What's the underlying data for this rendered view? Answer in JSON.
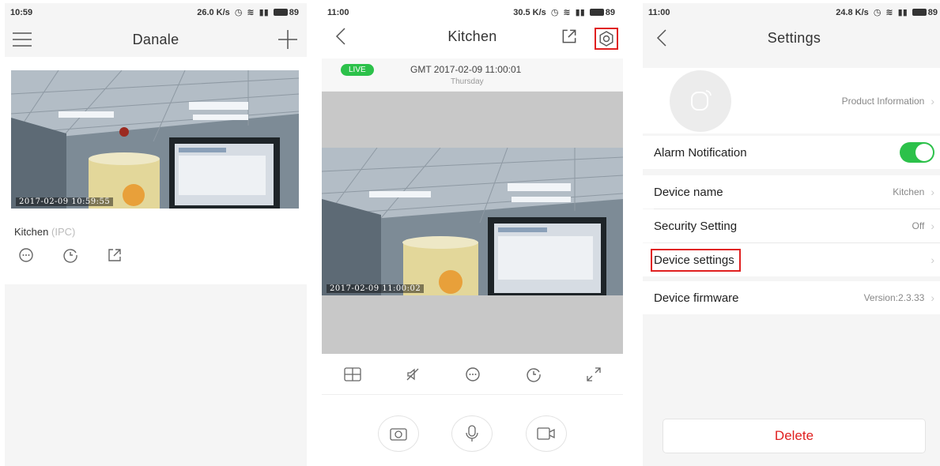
{
  "screen1": {
    "status": {
      "time": "10:59",
      "speed": "26.0 K/s",
      "battery": "89"
    },
    "title": "Danale",
    "camera": {
      "timestamp": "2017-02-09 10:59:55"
    },
    "device_name": "Kitchen",
    "device_type": "(IPC)",
    "icons": [
      "menu-icon",
      "add-icon",
      "message-icon",
      "history-icon",
      "share-icon"
    ]
  },
  "screen2": {
    "status": {
      "time": "11:00",
      "speed": "30.5 K/s",
      "battery": "89"
    },
    "title": "Kitchen",
    "live_badge": "LIVE",
    "datetime": "GMT 2017-02-09 11:00:01",
    "weekday": "Thursday",
    "camera": {
      "timestamp": "2017-02-09 11:00:02"
    },
    "icons": [
      "back-icon",
      "share-icon",
      "settings-icon",
      "split-view-icon",
      "mute-icon",
      "message-icon",
      "history-icon",
      "fullscreen-icon",
      "snapshot-icon",
      "microphone-icon",
      "record-icon"
    ],
    "highlight_color": "#e02020"
  },
  "screen3": {
    "status": {
      "time": "11:00",
      "speed": "24.8 K/s",
      "battery": "89"
    },
    "title": "Settings",
    "product_info": "Product Information",
    "rows": [
      {
        "label": "Alarm Notification",
        "toggle": true
      },
      {
        "label": "Device name",
        "value": "Kitchen"
      },
      {
        "label": "Security Setting",
        "value": "Off"
      },
      {
        "label": "Device settings",
        "value": ""
      },
      {
        "label": "Device firmware",
        "value": "Version:2.3.33"
      }
    ],
    "delete_label": "Delete",
    "colors": {
      "toggle_on": "#2cc14a",
      "delete_text": "#e02020",
      "highlight": "#e02020"
    }
  }
}
